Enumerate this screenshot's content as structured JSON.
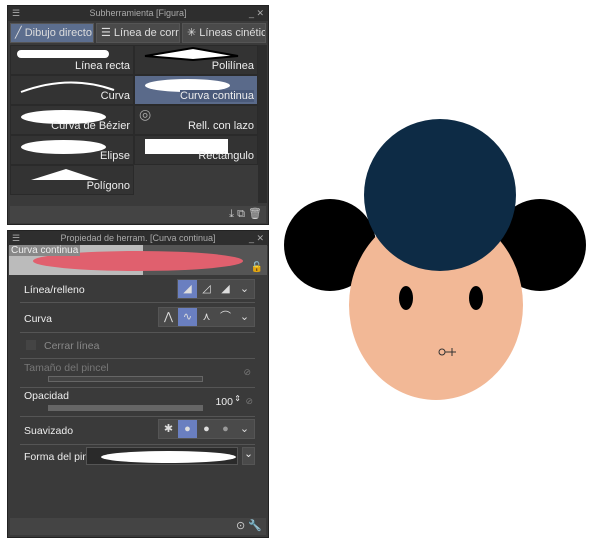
{
  "subtool_panel": {
    "title": "Subherramienta [Figura]",
    "tabs": [
      {
        "label": "Dibujo directo",
        "selected": true
      },
      {
        "label": "Línea de corrien"
      },
      {
        "label": "Líneas cinéticas"
      }
    ],
    "items": [
      {
        "label": "Línea recta"
      },
      {
        "label": "Polilínea"
      },
      {
        "label": "Curva"
      },
      {
        "label": "Curva continua",
        "selected": true
      },
      {
        "label": "Curva de Bézier"
      },
      {
        "label": "Rell. con lazo"
      },
      {
        "label": "Elipse"
      },
      {
        "label": "Rectángulo"
      },
      {
        "label": "Polígono"
      }
    ]
  },
  "property_panel": {
    "title": "Propiedad de herram. [Curva continua]",
    "preview_label": "Curva continua",
    "preview_color": "#e0606e",
    "line_fill": "Línea/relleno",
    "curve": "Curva",
    "close_line": "Cerrar línea",
    "brush_size": "Tamaño del pincel",
    "opacity": "Opacidad",
    "opacity_value": "100",
    "smoothing": "Suavizado",
    "brush_shape": "Forma del pincel"
  },
  "canvas": {
    "hat_color": "#0d2b45",
    "face_color": "#f2b896",
    "hair_color": "#000000"
  }
}
